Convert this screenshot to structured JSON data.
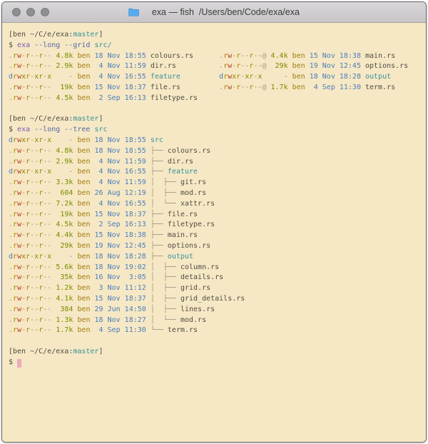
{
  "window": {
    "title": "exa — fish  /Users/ben/Code/exa/exa",
    "icon": "folder-icon",
    "traffic_lights": [
      "close",
      "minimize",
      "zoom"
    ]
  },
  "palette": {
    "bg": "#f6e8c4",
    "fg": "#4f4c44",
    "gray": "#9d9786",
    "red": "#c13927",
    "yellow": "#a98300",
    "user": "#a07c10",
    "green": "#7c8a00",
    "blue": "#4a7dbd",
    "teal": "#35919b",
    "purple": "#755cb8",
    "option": "#5566aa",
    "cursor": "#eeaabf",
    "titlebar_text": "#3b3b3b",
    "folder_icon": "#58aaec"
  },
  "terminal": {
    "perm_char_colors": {
      "r": "yellow",
      "w": "red",
      "x": "green",
      "d": "blue",
      "-": "gray",
      ".": "gray",
      "@": "gray"
    },
    "lines": [
      [
        [
          "fg",
          "[ben ~/C/e/exa:"
        ],
        [
          "teal",
          "master"
        ],
        [
          "fg",
          "]"
        ]
      ],
      [
        [
          "fg",
          "$ "
        ],
        [
          "purple",
          "exa "
        ],
        [
          "option",
          "--long --grid "
        ],
        [
          "teal",
          "src/"
        ]
      ],
      [
        [
          "perms",
          ".rw-r--r--"
        ],
        [
          "green",
          " 4.8k "
        ],
        [
          "user",
          "ben "
        ],
        [
          "blue",
          "18 Nov 18:55 "
        ],
        [
          "fg",
          "colours.rs"
        ],
        [
          "fg",
          "      "
        ],
        [
          "perms",
          ".rw-r--r--@"
        ],
        [
          "green",
          " 4.4k "
        ],
        [
          "user",
          "ben "
        ],
        [
          "blue",
          "15 Nov 18:38 "
        ],
        [
          "fg",
          "main.rs"
        ]
      ],
      [
        [
          "perms",
          ".rw-r--r--"
        ],
        [
          "green",
          " 2.9k "
        ],
        [
          "user",
          "ben "
        ],
        [
          "blue",
          " 4 Nov 11:59 "
        ],
        [
          "fg",
          "dir.rs"
        ],
        [
          "fg",
          "          "
        ],
        [
          "perms",
          ".rw-r--r--@"
        ],
        [
          "green",
          "  29k "
        ],
        [
          "user",
          "ben "
        ],
        [
          "blue",
          "19 Nov 12:45 "
        ],
        [
          "fg",
          "options.rs"
        ]
      ],
      [
        [
          "perms",
          "drwxr-xr-x"
        ],
        [
          "gray",
          "    - "
        ],
        [
          "user",
          "ben "
        ],
        [
          "blue",
          " 4 Nov 16:55 "
        ],
        [
          "teal",
          "feature"
        ],
        [
          "fg",
          "         "
        ],
        [
          "perms",
          "drwxr-xr-x"
        ],
        [
          "gray",
          "     - "
        ],
        [
          "user",
          "ben "
        ],
        [
          "blue",
          "18 Nov 18:28 "
        ],
        [
          "teal",
          "output"
        ]
      ],
      [
        [
          "perms",
          ".rw-r--r--"
        ],
        [
          "green",
          "  19k "
        ],
        [
          "user",
          "ben "
        ],
        [
          "blue",
          "15 Nov 18:37 "
        ],
        [
          "fg",
          "file.rs"
        ],
        [
          "fg",
          "         "
        ],
        [
          "perms",
          ".rw-r--r--@"
        ],
        [
          "green",
          " 1.7k "
        ],
        [
          "user",
          "ben "
        ],
        [
          "blue",
          " 4 Sep 11:30 "
        ],
        [
          "fg",
          "term.rs"
        ]
      ],
      [
        [
          "perms",
          ".rw-r--r--"
        ],
        [
          "green",
          " 4.5k "
        ],
        [
          "user",
          "ben "
        ],
        [
          "blue",
          " 2 Sep 16:13 "
        ],
        [
          "fg",
          "filetype.rs"
        ]
      ],
      [],
      [
        [
          "fg",
          "[ben ~/C/e/exa:"
        ],
        [
          "teal",
          "master"
        ],
        [
          "fg",
          "]"
        ]
      ],
      [
        [
          "fg",
          "$ "
        ],
        [
          "purple",
          "exa "
        ],
        [
          "option",
          "--long --tree "
        ],
        [
          "teal",
          "src"
        ]
      ],
      [
        [
          "perms",
          "drwxr-xr-x"
        ],
        [
          "gray",
          "    - "
        ],
        [
          "user",
          "ben "
        ],
        [
          "blue",
          "18 Nov 18:55 "
        ],
        [
          "teal",
          "src"
        ]
      ],
      [
        [
          "perms",
          ".rw-r--r--"
        ],
        [
          "green",
          " 4.8k "
        ],
        [
          "user",
          "ben "
        ],
        [
          "blue",
          "18 Nov 18:55 "
        ],
        [
          "gray",
          "├── "
        ],
        [
          "fg",
          "colours.rs"
        ]
      ],
      [
        [
          "perms",
          ".rw-r--r--"
        ],
        [
          "green",
          " 2.9k "
        ],
        [
          "user",
          "ben "
        ],
        [
          "blue",
          " 4 Nov 11:59 "
        ],
        [
          "gray",
          "├── "
        ],
        [
          "fg",
          "dir.rs"
        ]
      ],
      [
        [
          "perms",
          "drwxr-xr-x"
        ],
        [
          "gray",
          "    - "
        ],
        [
          "user",
          "ben "
        ],
        [
          "blue",
          " 4 Nov 16:55 "
        ],
        [
          "gray",
          "├── "
        ],
        [
          "teal",
          "feature"
        ]
      ],
      [
        [
          "perms",
          ".rw-r--r--"
        ],
        [
          "green",
          " 3.3k "
        ],
        [
          "user",
          "ben "
        ],
        [
          "blue",
          " 4 Nov 11:59 "
        ],
        [
          "gray",
          "│  ├── "
        ],
        [
          "fg",
          "git.rs"
        ]
      ],
      [
        [
          "perms",
          ".rw-r--r--"
        ],
        [
          "green",
          "  604 "
        ],
        [
          "user",
          "ben "
        ],
        [
          "blue",
          "26 Aug 12:19 "
        ],
        [
          "gray",
          "│  ├── "
        ],
        [
          "fg",
          "mod.rs"
        ]
      ],
      [
        [
          "perms",
          ".rw-r--r--"
        ],
        [
          "green",
          " 7.2k "
        ],
        [
          "user",
          "ben "
        ],
        [
          "blue",
          " 4 Nov 16:55 "
        ],
        [
          "gray",
          "│  └── "
        ],
        [
          "fg",
          "xattr.rs"
        ]
      ],
      [
        [
          "perms",
          ".rw-r--r--"
        ],
        [
          "green",
          "  19k "
        ],
        [
          "user",
          "ben "
        ],
        [
          "blue",
          "15 Nov 18:37 "
        ],
        [
          "gray",
          "├── "
        ],
        [
          "fg",
          "file.rs"
        ]
      ],
      [
        [
          "perms",
          ".rw-r--r--"
        ],
        [
          "green",
          " 4.5k "
        ],
        [
          "user",
          "ben "
        ],
        [
          "blue",
          " 2 Sep 16:13 "
        ],
        [
          "gray",
          "├── "
        ],
        [
          "fg",
          "filetype.rs"
        ]
      ],
      [
        [
          "perms",
          ".rw-r--r--"
        ],
        [
          "green",
          " 4.4k "
        ],
        [
          "user",
          "ben "
        ],
        [
          "blue",
          "15 Nov 18:38 "
        ],
        [
          "gray",
          "├── "
        ],
        [
          "fg",
          "main.rs"
        ]
      ],
      [
        [
          "perms",
          ".rw-r--r--"
        ],
        [
          "green",
          "  29k "
        ],
        [
          "user",
          "ben "
        ],
        [
          "blue",
          "19 Nov 12:45 "
        ],
        [
          "gray",
          "├── "
        ],
        [
          "fg",
          "options.rs"
        ]
      ],
      [
        [
          "perms",
          "drwxr-xr-x"
        ],
        [
          "gray",
          "    - "
        ],
        [
          "user",
          "ben "
        ],
        [
          "blue",
          "18 Nov 18:28 "
        ],
        [
          "gray",
          "├── "
        ],
        [
          "teal",
          "output"
        ]
      ],
      [
        [
          "perms",
          ".rw-r--r--"
        ],
        [
          "green",
          " 5.6k "
        ],
        [
          "user",
          "ben "
        ],
        [
          "blue",
          "18 Nov 19:02 "
        ],
        [
          "gray",
          "│  ├── "
        ],
        [
          "fg",
          "column.rs"
        ]
      ],
      [
        [
          "perms",
          ".rw-r--r--"
        ],
        [
          "green",
          "  35k "
        ],
        [
          "user",
          "ben "
        ],
        [
          "blue",
          "16 Nov  3:05 "
        ],
        [
          "gray",
          "│  ├── "
        ],
        [
          "fg",
          "details.rs"
        ]
      ],
      [
        [
          "perms",
          ".rw-r--r--"
        ],
        [
          "green",
          " 1.2k "
        ],
        [
          "user",
          "ben "
        ],
        [
          "blue",
          " 3 Nov 11:12 "
        ],
        [
          "gray",
          "│  ├── "
        ],
        [
          "fg",
          "grid.rs"
        ]
      ],
      [
        [
          "perms",
          ".rw-r--r--"
        ],
        [
          "green",
          " 4.1k "
        ],
        [
          "user",
          "ben "
        ],
        [
          "blue",
          "15 Nov 18:37 "
        ],
        [
          "gray",
          "│  ├── "
        ],
        [
          "fg",
          "grid_details.rs"
        ]
      ],
      [
        [
          "perms",
          ".rw-r--r--"
        ],
        [
          "green",
          "  384 "
        ],
        [
          "user",
          "ben "
        ],
        [
          "blue",
          "29 Jun 14:50 "
        ],
        [
          "gray",
          "│  ├── "
        ],
        [
          "fg",
          "lines.rs"
        ]
      ],
      [
        [
          "perms",
          ".rw-r--r--"
        ],
        [
          "green",
          " 1.3k "
        ],
        [
          "user",
          "ben "
        ],
        [
          "blue",
          "18 Nov 18:27 "
        ],
        [
          "gray",
          "│  └── "
        ],
        [
          "fg",
          "mod.rs"
        ]
      ],
      [
        [
          "perms",
          ".rw-r--r--"
        ],
        [
          "green",
          " 1.7k "
        ],
        [
          "user",
          "ben "
        ],
        [
          "blue",
          " 4 Sep 11:30 "
        ],
        [
          "gray",
          "└── "
        ],
        [
          "fg",
          "term.rs"
        ]
      ],
      [],
      [
        [
          "fg",
          "[ben ~/C/e/exa:"
        ],
        [
          "teal",
          "master"
        ],
        [
          "fg",
          "]"
        ]
      ],
      [
        [
          "fg",
          "$ "
        ],
        [
          "cursor",
          " "
        ]
      ]
    ]
  }
}
